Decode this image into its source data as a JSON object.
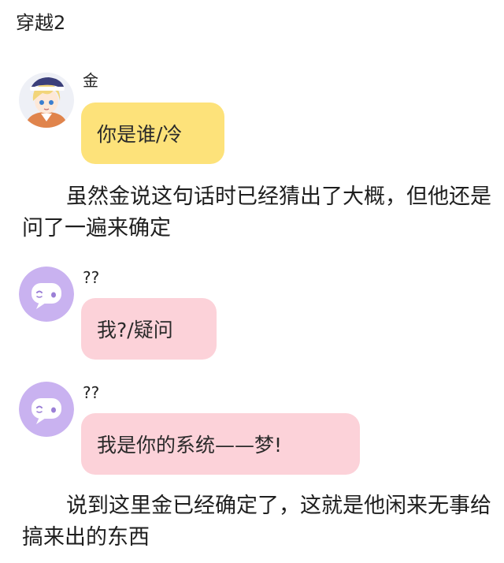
{
  "page": {
    "title": "穿越2"
  },
  "messages": [
    {
      "sender": "金",
      "text": "你是谁/冷",
      "bubble_color": "#fde27a",
      "avatar": "anime-character-avatar"
    },
    {
      "sender": "??",
      "text": "我?/疑问",
      "bubble_color": "#fcd2d9",
      "avatar": "purple-chat-bubble-avatar"
    },
    {
      "sender": "??",
      "text": "我是你的系统——梦!",
      "bubble_color": "#fcd2d9",
      "avatar": "purple-chat-bubble-avatar"
    }
  ],
  "narration": [
    "虽然金说这句话时已经猜出了大概，但他还是问了一遍来确定",
    "说到这里金已经确定了，这就是他闲来无事给搞来出的东西"
  ],
  "colors": {
    "yellow_bubble": "#fde27a",
    "pink_bubble": "#fcd2d9",
    "purple_avatar": "#c9b2f0"
  }
}
